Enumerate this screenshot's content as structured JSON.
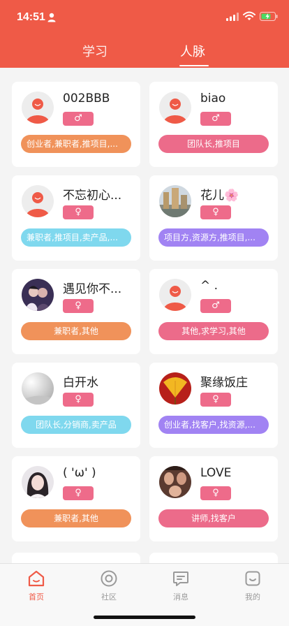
{
  "status": {
    "time": "14:51"
  },
  "tabs": [
    {
      "label": "学习"
    },
    {
      "label": "人脉"
    }
  ],
  "cards": [
    {
      "name": "002BBB",
      "gender": "♂",
      "tags": "创业者,兼职者,推项目,...",
      "tag_color": "#f0925a",
      "avatar": "default"
    },
    {
      "name": "biao",
      "gender": "♂",
      "tags": "团队长,推项目",
      "tag_color": "#ec6b8a",
      "avatar": "default"
    },
    {
      "name": "不忘初心...",
      "gender": "♀",
      "tags": "兼职者,推项目,卖产品,...",
      "tag_color": "#7fd8ee",
      "avatar": "default"
    },
    {
      "name": "花儿🌸",
      "gender": "♀",
      "tags": "项目方,资源方,推项目,...",
      "tag_color": "#a183f3",
      "avatar": "photo-city"
    },
    {
      "name": "遇见你不...",
      "gender": "♀",
      "tags": "兼职者,其他",
      "tag_color": "#f0925a",
      "avatar": "photo-couple"
    },
    {
      "name": "^ .",
      "gender": "♂",
      "tags": "其他,求学习,其他",
      "tag_color": "#ec6b8a",
      "avatar": "default"
    },
    {
      "name": "白开水",
      "gender": "♀",
      "tags": "团队长,分销商,卖产品",
      "tag_color": "#7fd8ee",
      "avatar": "photo-gray"
    },
    {
      "name": "聚缘饭庄",
      "gender": "♀",
      "tags": "创业者,找客户,找资源,...",
      "tag_color": "#a183f3",
      "avatar": "photo-leaf"
    },
    {
      "name": "( 'ω' )",
      "gender": "♀",
      "tags": "兼职者,其他",
      "tag_color": "#f0925a",
      "avatar": "photo-girl"
    },
    {
      "name": "LOVE",
      "gender": "♀",
      "tags": "讲师,找客户",
      "tag_color": "#ec6b8a",
      "avatar": "photo-faces"
    }
  ],
  "bottom_nav": [
    {
      "label": "首页",
      "icon": "home-icon",
      "active": true
    },
    {
      "label": "社区",
      "icon": "community-icon",
      "active": false
    },
    {
      "label": "消息",
      "icon": "message-icon",
      "active": false
    },
    {
      "label": "我的",
      "icon": "profile-icon",
      "active": false
    }
  ],
  "colors": {
    "brand": "#ef5a47",
    "gender_badge": "#ee6b8a",
    "nav_active": "#ef5a47",
    "nav_inactive": "#9a9a9a"
  }
}
